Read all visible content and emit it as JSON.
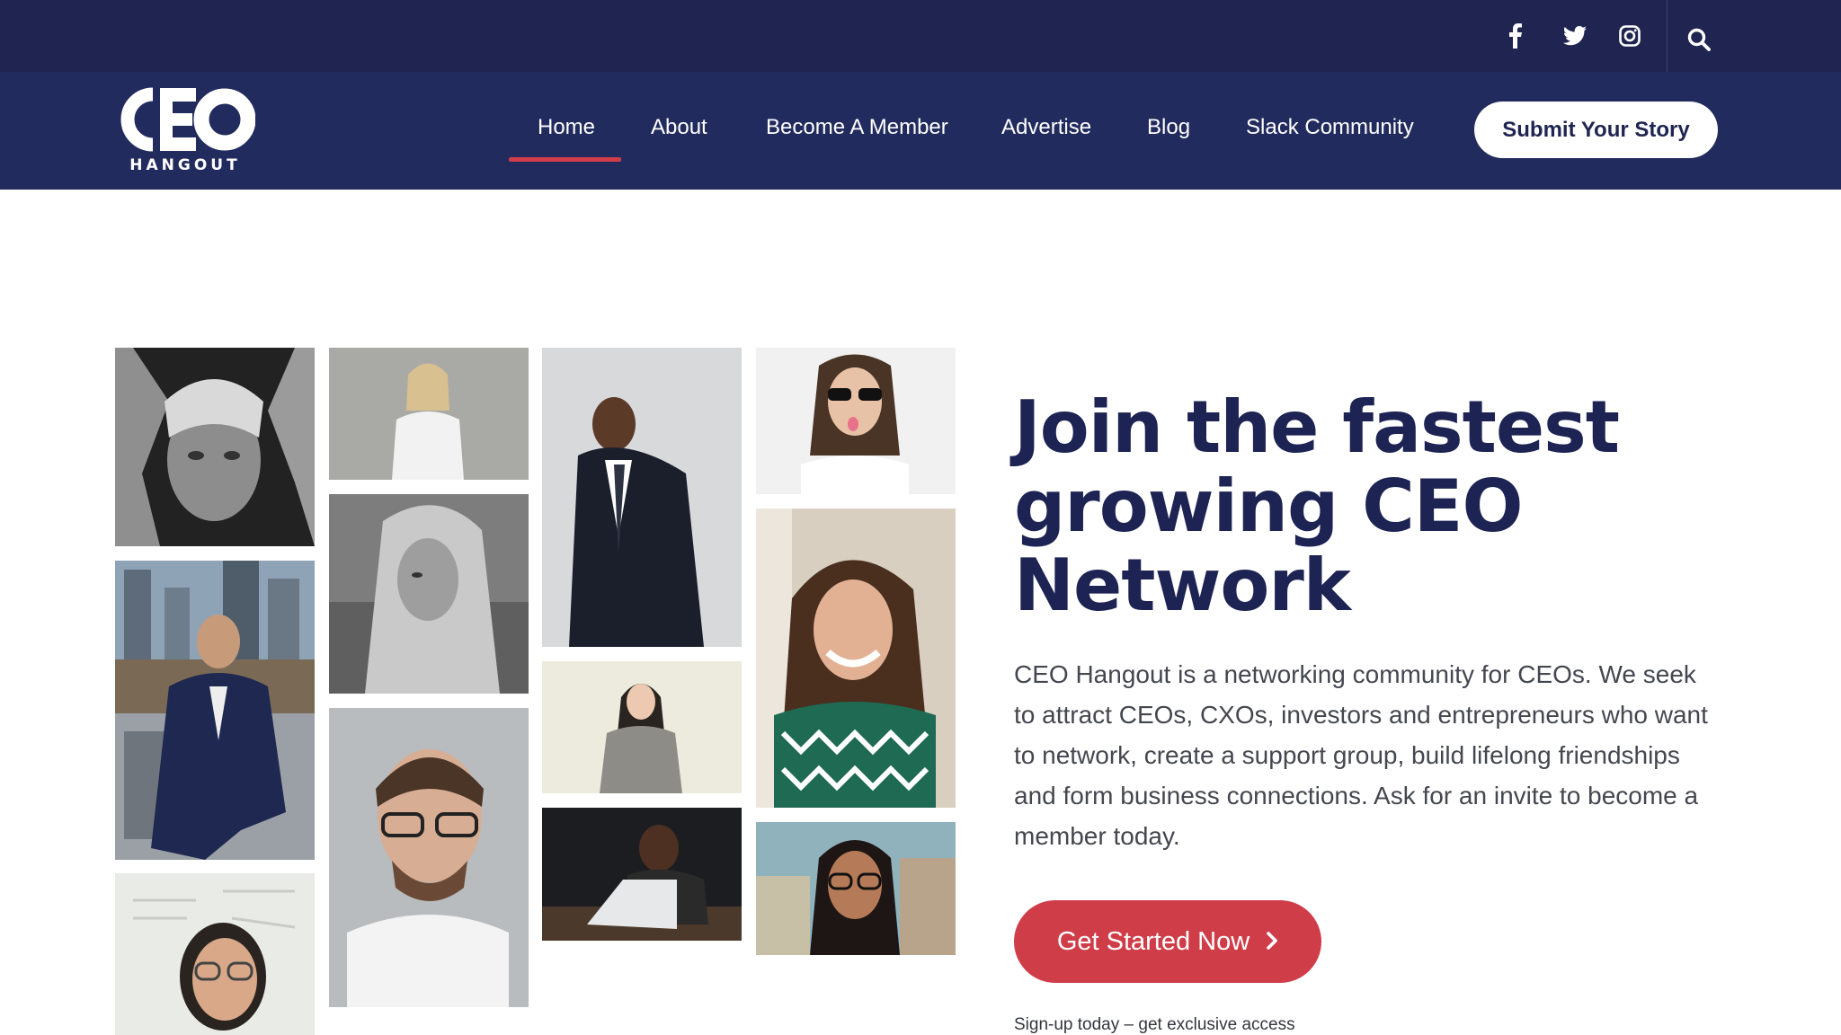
{
  "topbar": {
    "social": [
      {
        "icon": "facebook-icon"
      },
      {
        "icon": "twitter-icon"
      },
      {
        "icon": "instagram-icon"
      }
    ],
    "search_icon": "search-icon"
  },
  "logo": {
    "mark": "CEO",
    "subtitle": "HANGOUT"
  },
  "nav": {
    "items": [
      {
        "label": "Home",
        "active": true
      },
      {
        "label": "About"
      },
      {
        "label": "Become A Member"
      },
      {
        "label": "Advertise"
      },
      {
        "label": "Blog"
      },
      {
        "label": "Slack Community"
      }
    ],
    "cta_label": "Submit Your Story"
  },
  "hero": {
    "headline_lines": [
      "Join the fastest",
      "growing CEO",
      "Network"
    ],
    "description": "CEO Hangout is a networking community for CEOs. We seek to attract CEOs, CXOs, investors and entrepreneurs who want to network, create a support group, build lifelong friendships and form business connections. Ask for an invite to become a member today.",
    "cta_label": "Get Started Now",
    "cta_icon": "chevron-right-icon",
    "note": "Sign-up today – get exclusive access"
  },
  "colors": {
    "topbar": "#1f2550",
    "navbar": "#222b5e",
    "accent_red": "#cf3d49",
    "headline": "#1d2353"
  }
}
